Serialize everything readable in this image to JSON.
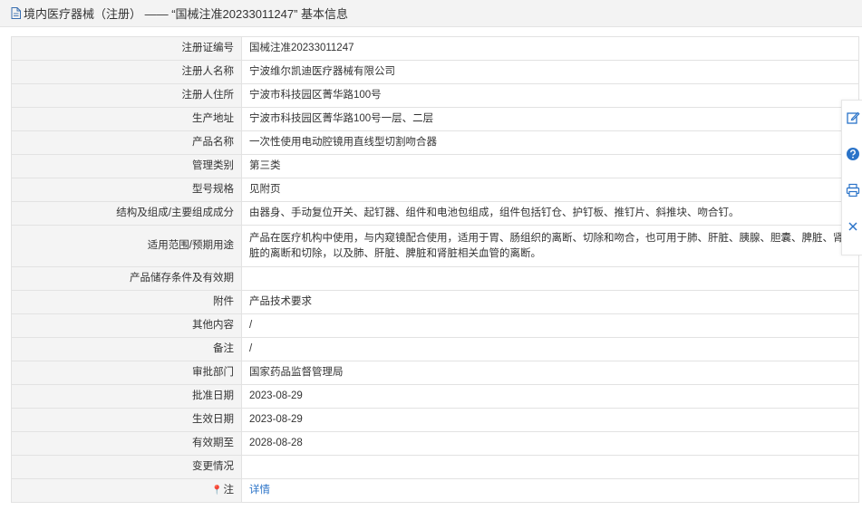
{
  "header": {
    "title": "境内医疗器械（注册） —— “国械注准20233011247” 基本信息"
  },
  "rows": [
    {
      "label": "注册证编号",
      "value": "国械注准20233011247"
    },
    {
      "label": "注册人名称",
      "value": "宁波维尔凯迪医疗器械有限公司"
    },
    {
      "label": "注册人住所",
      "value": "宁波市科技园区菁华路100号"
    },
    {
      "label": "生产地址",
      "value": "宁波市科技园区菁华路100号一层、二层"
    },
    {
      "label": "产品名称",
      "value": "一次性使用电动腔镜用直线型切割吻合器"
    },
    {
      "label": "管理类别",
      "value": "第三类"
    },
    {
      "label": "型号规格",
      "value": "见附页"
    },
    {
      "label": "结构及组成/主要组成成分",
      "value": "由器身、手动复位开关、起钉器、组件和电池包组成，组件包括钉仓、护钉板、推钉片、斜推块、吻合钉。"
    },
    {
      "label": "适用范围/预期用途",
      "value": "产品在医疗机构中使用，与内窥镜配合使用，适用于胃、肠组织的离断、切除和吻合，也可用于肺、肝脏、胰腺、胆囊、脾脏、肾脏的离断和切除，以及肺、肝脏、脾脏和肾脏相关血管的离断。"
    },
    {
      "label": "产品储存条件及有效期",
      "value": ""
    },
    {
      "label": "附件",
      "value": "产品技术要求"
    },
    {
      "label": "其他内容",
      "value": "/"
    },
    {
      "label": "备注",
      "value": "/"
    },
    {
      "label": "审批部门",
      "value": "国家药品监督管理局"
    },
    {
      "label": "批准日期",
      "value": "2023-08-29"
    },
    {
      "label": "生效日期",
      "value": "2023-08-29"
    },
    {
      "label": "有效期至",
      "value": "2028-08-28"
    },
    {
      "label": "变更情况",
      "value": ""
    }
  ],
  "note_row": {
    "label": "注",
    "link_text": "详情"
  },
  "side_tools": [
    {
      "icon": "edit-icon"
    },
    {
      "icon": "help-icon"
    },
    {
      "icon": "print-icon"
    },
    {
      "icon": "close-icon"
    }
  ],
  "colors": {
    "label_bg": "#f4f4f4",
    "border": "#e2e2e2",
    "link": "#2a73c8",
    "tool_blue": "#2a73c8"
  }
}
